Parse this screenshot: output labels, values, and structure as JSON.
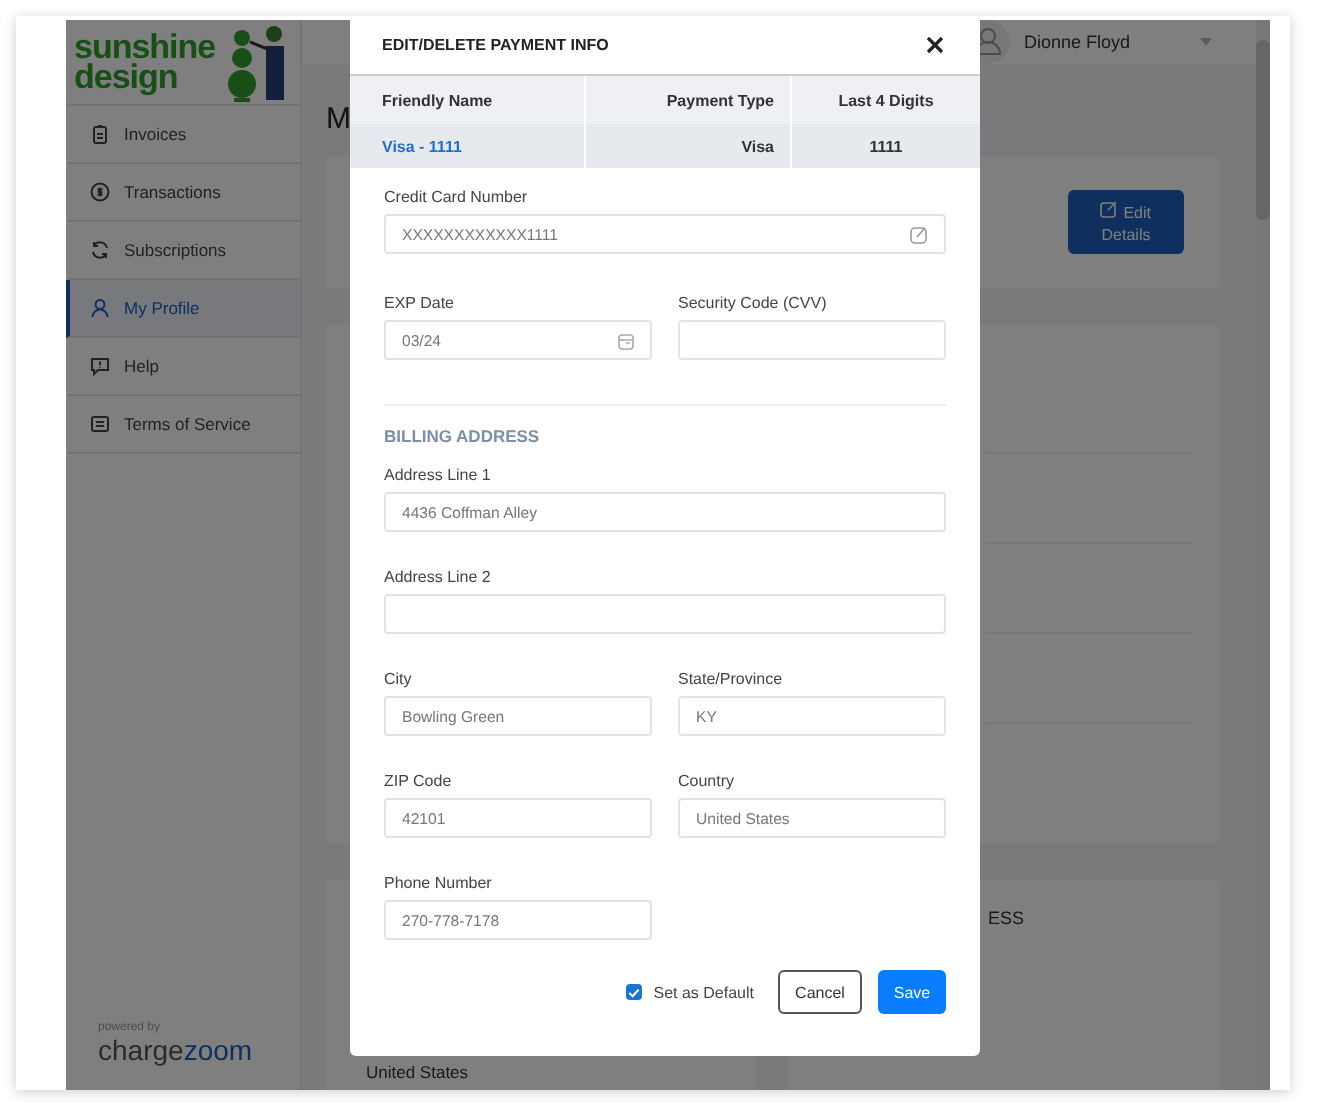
{
  "sidebar": {
    "logo_text": "sunshine design",
    "items": [
      {
        "label": "Invoices",
        "selected": false
      },
      {
        "label": "Transactions",
        "selected": false
      },
      {
        "label": "Subscriptions",
        "selected": false
      },
      {
        "label": "My Profile",
        "selected": true
      },
      {
        "label": "Help",
        "selected": false
      },
      {
        "label": "Terms of Service",
        "selected": false
      }
    ],
    "powered_by": "powered by",
    "brand": [
      "charge",
      "zoom"
    ]
  },
  "header": {
    "user_name": "Dionne Floyd"
  },
  "page": {
    "title": "M",
    "edit_button": "Edit Details",
    "section_heading": "ESS",
    "address_lines": [
      "United States"
    ]
  },
  "modal": {
    "title": "EDIT/DELETE PAYMENT INFO",
    "table": {
      "columns": [
        "Friendly Name",
        "Payment Type",
        "Last 4 Digits"
      ],
      "rows": [
        {
          "cells": [
            "Visa - 1111",
            "Visa",
            "1111"
          ]
        }
      ]
    },
    "sections": [
      {
        "rows": [
          [
            {
              "label": "Credit Card Number",
              "value": "XXXXXXXXXXXX1111",
              "kind": "edit"
            }
          ],
          [
            {
              "label": "EXP Date",
              "value": "03/24",
              "kind": "date"
            },
            {
              "label": "Security Code (CVV)",
              "kind": "text"
            }
          ]
        ]
      },
      {
        "heading": "BILLING ADDRESS",
        "rows": [
          [
            {
              "label": "Address Line 1",
              "value": "4436 Coffman Alley",
              "kind": "text"
            }
          ],
          [
            {
              "label": "Address Line 2",
              "kind": "text"
            }
          ],
          [
            {
              "label": "City",
              "value": "Bowling Green",
              "kind": "text"
            },
            {
              "label": "State/Province",
              "value": "KY",
              "kind": "text"
            }
          ],
          [
            {
              "label": "ZIP Code",
              "value": "42101",
              "kind": "text"
            },
            {
              "label": "Country",
              "value": "United States",
              "kind": "text"
            }
          ],
          [
            {
              "label": "Phone Number",
              "value": "270-778-7178",
              "kind": "text"
            }
          ]
        ]
      }
    ],
    "default_checkbox": {
      "label": "Set as Default",
      "checked": true
    },
    "buttons": {
      "cancel": "Cancel",
      "save": "Save"
    }
  }
}
